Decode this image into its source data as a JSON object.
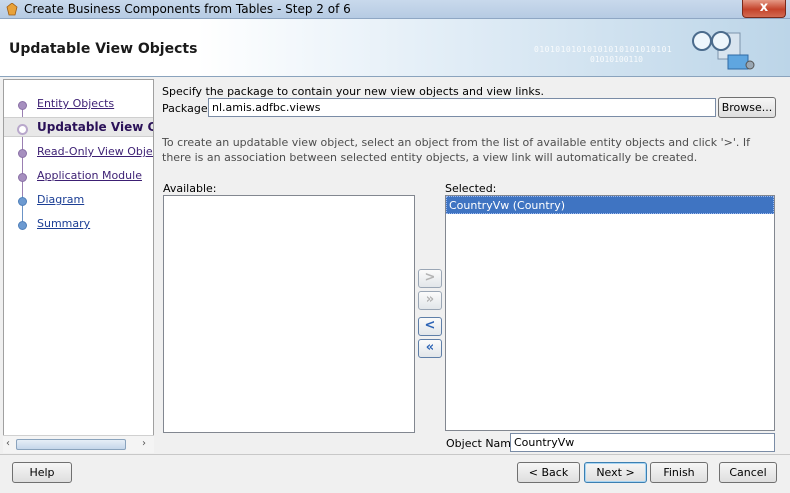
{
  "window": {
    "title": "Create Business Components from Tables - Step 2 of 6",
    "close_label": "x"
  },
  "banner": {
    "heading": "Updatable View Objects",
    "binary_line1": "01010101010101010101010101",
    "binary_line2": "01010100110"
  },
  "nav": {
    "items": [
      {
        "label": "Entity Objects",
        "state": "visited"
      },
      {
        "label": "Updatable View Objects",
        "state": "current"
      },
      {
        "label": "Read-Only View Objects",
        "state": "pending"
      },
      {
        "label": "Application Module",
        "state": "pending"
      },
      {
        "label": "Diagram",
        "state": "pending"
      },
      {
        "label": "Summary",
        "state": "pending"
      }
    ]
  },
  "main": {
    "spec_text": "Specify the package to contain your new view objects and view links.",
    "package_label": "Package:",
    "package_value": "nl.amis.adfbc.views",
    "browse_label": "Browse...",
    "info_text": "To create an updatable view object, select an object from the list of available entity objects and click '>'.  If there is an association between selected entity objects, a view link will automatically be created.",
    "available_label": "Available:",
    "available_items": [],
    "selected_label": "Selected:",
    "selected_items": [
      "CountryVw (Country)"
    ],
    "object_name_label": "Object Name:",
    "object_name_value": "CountryVw",
    "shuttle": {
      "add": ">",
      "add_all": "»",
      "remove": "<",
      "remove_all": "«"
    }
  },
  "buttons": {
    "help": "Help",
    "back": "< Back",
    "next": "Next >",
    "finish": "Finish",
    "cancel": "Cancel"
  }
}
